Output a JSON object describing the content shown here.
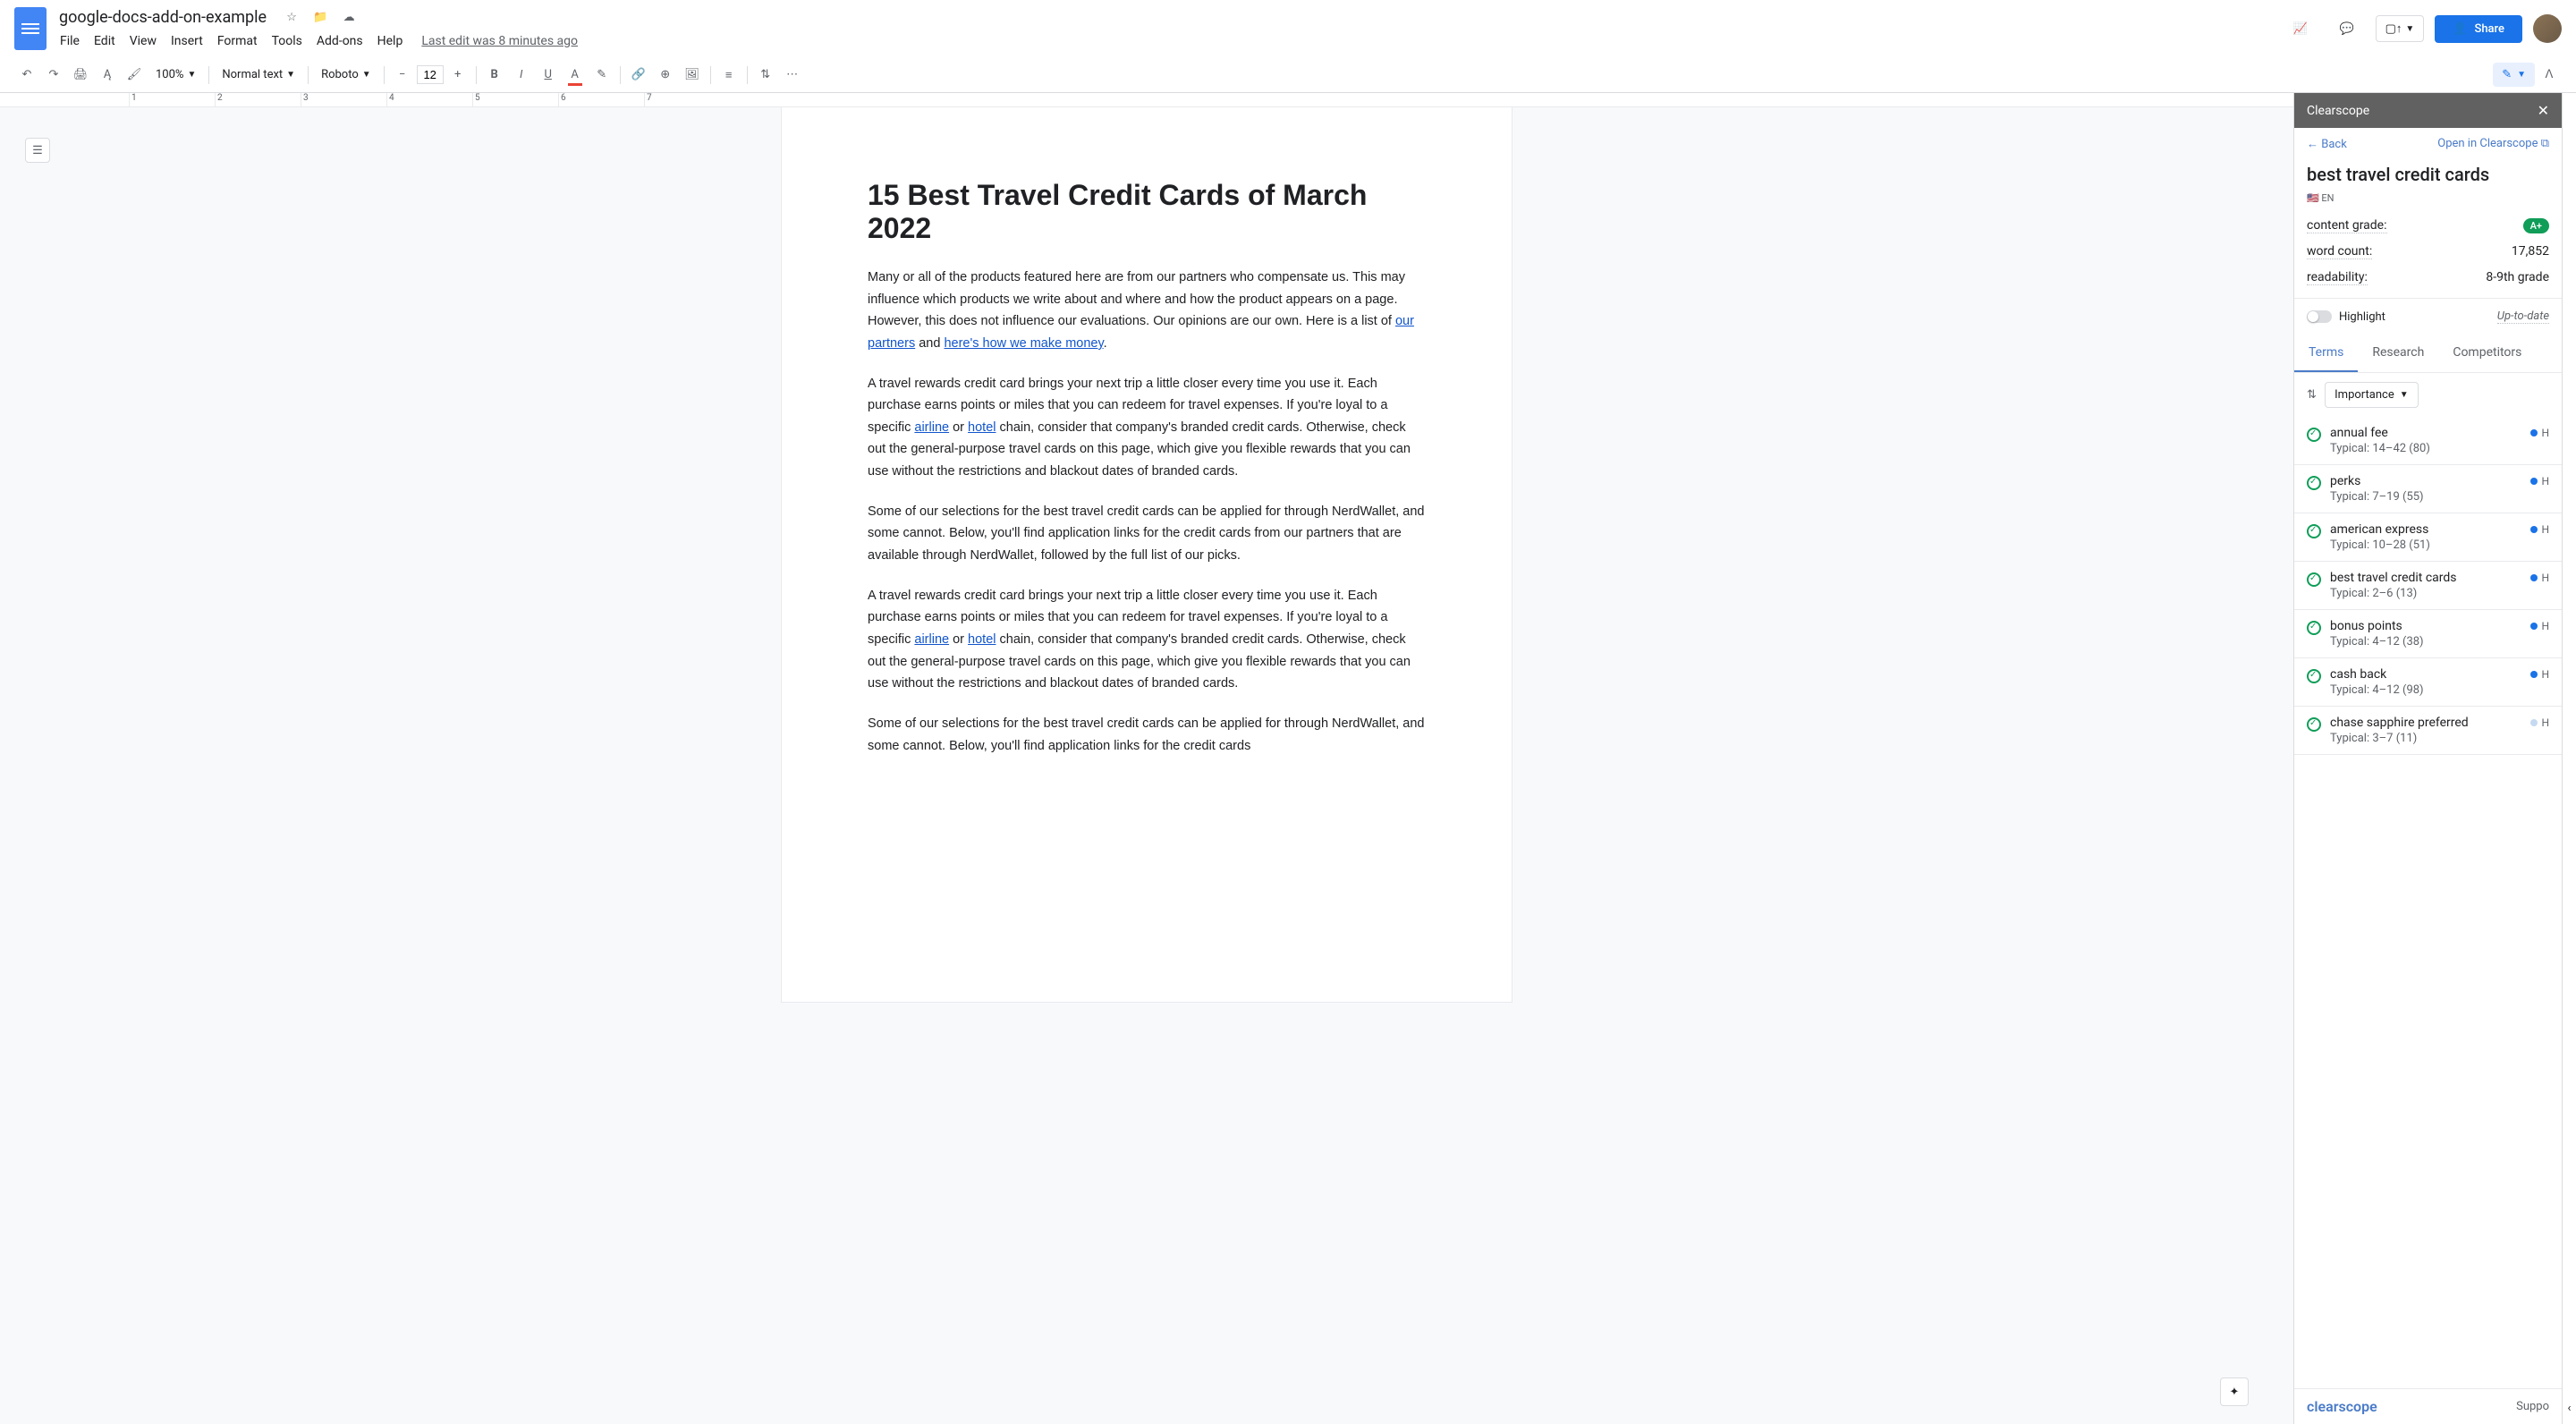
{
  "header": {
    "doc_title": "google-docs-add-on-example",
    "menus": [
      "File",
      "Edit",
      "View",
      "Insert",
      "Format",
      "Tools",
      "Add-ons",
      "Help"
    ],
    "last_edit": "Last edit was 8 minutes ago",
    "share_label": "Share"
  },
  "toolbar": {
    "zoom": "100%",
    "style": "Normal text",
    "font": "Roboto",
    "font_size": "12"
  },
  "document": {
    "h1": "15 Best Travel Credit Cards of March 2022",
    "p1_a": "Many or all of the products featured here are from our partners who compensate us. This may influence which products we write about and where and how the product appears on a page. However, this does not influence our evaluations. Our opinions are our own. Here is a list of ",
    "link1": "our partners",
    "p1_b": " and ",
    "link2": "here's how we make money",
    "p1_c": ".",
    "p2_a": "A travel rewards credit card brings your next trip a little closer every time you use it. Each purchase earns points or miles that you can redeem for travel expenses. If you're loyal to a specific ",
    "link3": "airline",
    "p2_b": " or ",
    "link4": "hotel",
    "p2_c": " chain, consider that company's branded credit cards. Otherwise, check out the general-purpose travel cards on this page, which give you flexible rewards that you can use without the restrictions and blackout dates of branded cards.",
    "p3": "Some of our selections for the best travel credit cards can be applied for through NerdWallet, and some cannot.  Below, you'll find application links for the credit cards from our partners that are available through NerdWallet, followed by the full list of our picks.",
    "p4_a": "A travel rewards credit card brings your next trip a little closer every time you use it. Each purchase earns points or miles that you can redeem for travel expenses. If you're loyal to a specific ",
    "link5": "airline",
    "p4_b": " or ",
    "link6": "hotel",
    "p4_c": " chain, consider that company's branded credit cards. Otherwise, check out the general-purpose travel cards on this page, which give you flexible rewards that you can use without the restrictions and blackout dates of branded cards.",
    "p5": "Some of our selections for the best travel credit cards can be applied for through NerdWallet, and some cannot.  Below, you'll find application links for the credit cards"
  },
  "ruler": [
    "1",
    "",
    "",
    "2",
    "",
    "3",
    "",
    "4",
    "",
    "5",
    "",
    "6",
    "",
    "7",
    ""
  ],
  "sidebar": {
    "header": "Clearscope",
    "back": "Back",
    "open": "Open in Clearscope",
    "title": "best travel credit cards",
    "lang": "🇺🇸 EN",
    "stats": {
      "grade_label": "content grade:",
      "grade_value": "A+",
      "wc_label": "word count:",
      "wc_value": "17,852",
      "read_label": "readability:",
      "read_value": "8-9th grade"
    },
    "highlight_label": "Highlight",
    "status": "Up-to-date",
    "tabs": [
      "Terms",
      "Research",
      "Competitors"
    ],
    "sort": "Importance",
    "terms": [
      {
        "name": "annual fee",
        "typical": "Typical: 14–42 (80)",
        "badge": "H",
        "color": "#1a73e8"
      },
      {
        "name": "perks",
        "typical": "Typical: 7–19 (55)",
        "badge": "H",
        "color": "#1a73e8"
      },
      {
        "name": "american express",
        "typical": "Typical: 10–28 (51)",
        "badge": "H",
        "color": "#1a73e8"
      },
      {
        "name": "best travel credit cards",
        "typical": "Typical: 2–6 (13)",
        "badge": "H",
        "color": "#1a73e8"
      },
      {
        "name": "bonus points",
        "typical": "Typical: 4–12 (38)",
        "badge": "H",
        "color": "#1a73e8"
      },
      {
        "name": "cash back",
        "typical": "Typical: 4–12 (98)",
        "badge": "H",
        "color": "#1a73e8"
      },
      {
        "name": "chase sapphire preferred",
        "typical": "Typical: 3–7 (11)",
        "badge": "H",
        "color": "#c5d9f1"
      }
    ],
    "logo": "clearscope",
    "support": "Suppo"
  }
}
